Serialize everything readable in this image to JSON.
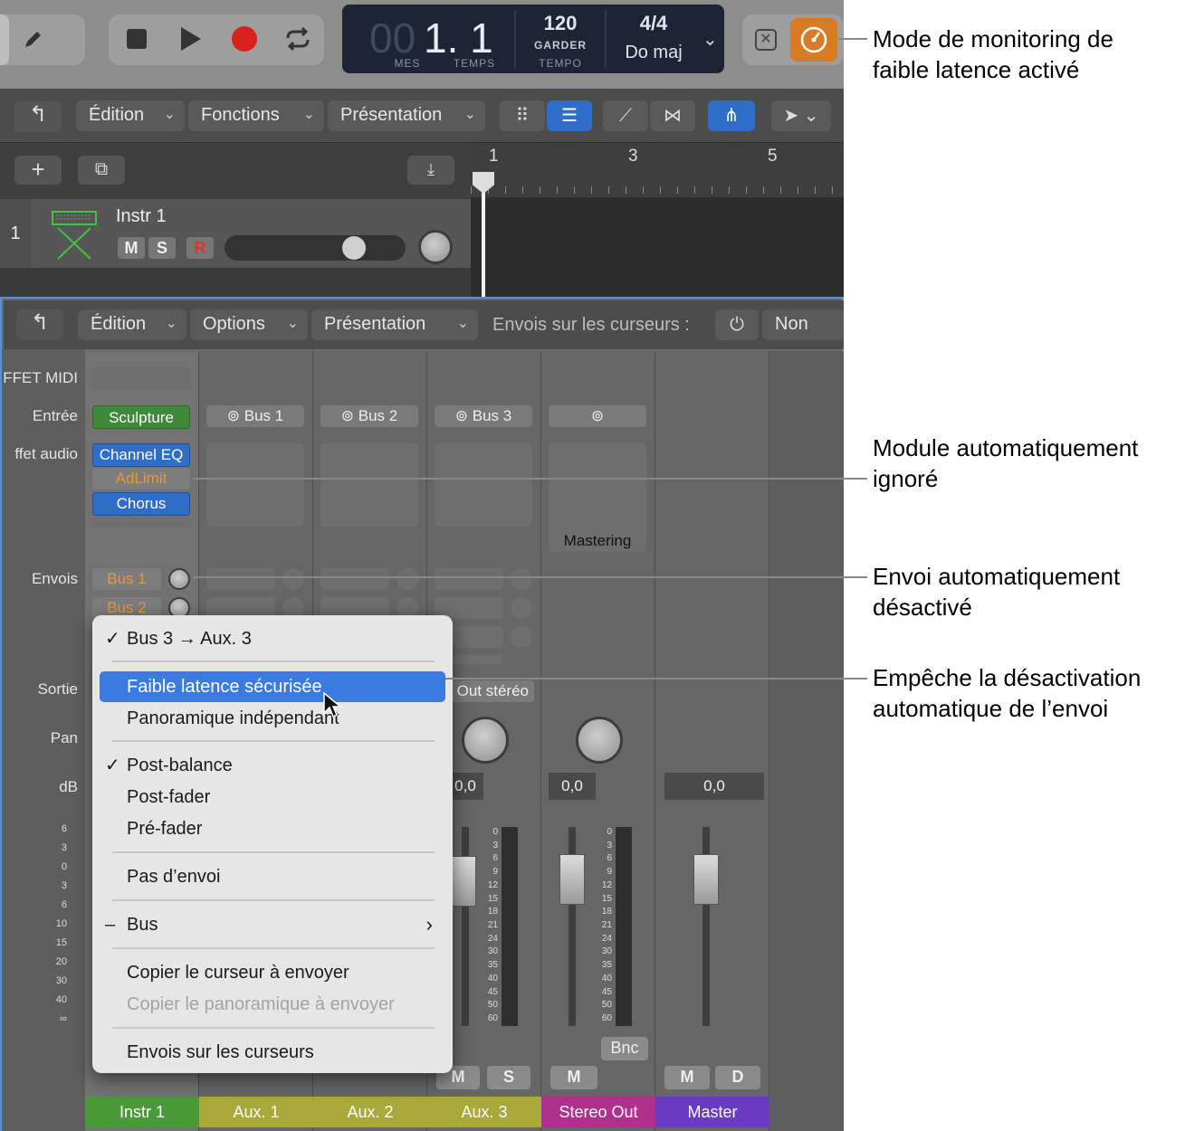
{
  "transport": {
    "lcd_bars": "00",
    "lcd_beat": "1. 1",
    "lcd_label_bars": "MES",
    "lcd_label_beat": "TEMPS",
    "tempo_value": "120",
    "tempo_mode": "GARDER",
    "tempo_label": "TEMPO",
    "signature": "4/4",
    "key": "Do maj"
  },
  "main_menubar": {
    "edit": "Édition",
    "functions": "Fonctions",
    "view": "Présentation"
  },
  "ruler": [
    "1",
    "3",
    "5"
  ],
  "track": {
    "number": "1",
    "name": "Instr 1",
    "mute": "M",
    "solo": "S",
    "record": "R"
  },
  "mixer_menubar": {
    "edit": "Édition",
    "options": "Options",
    "view": "Présentation",
    "sends_on_faders_label": "Envois sur les curseurs :",
    "sends_on_faders_value": "Non"
  },
  "row_labels": {
    "midi_fx": "FFET MIDI",
    "input": "Entrée",
    "audio_fx": "ffet audio",
    "sends": "Envois",
    "output": "Sortie",
    "pan": "Pan",
    "db": "dB"
  },
  "strip1": {
    "input": "Sculpture",
    "plugins": [
      "Channel EQ",
      "AdLimit",
      "Chorus"
    ],
    "sends": [
      "Bus 1",
      "Bus 2"
    ]
  },
  "inputs": [
    "Bus 1",
    "Bus 2",
    "Bus 3"
  ],
  "stereo_out": {
    "plugin": "Mastering",
    "output_fragment": "Out stéréo",
    "db": "0,0",
    "mute": "M",
    "bounce": "Bnc"
  },
  "aux3": {
    "db": "0,0",
    "mute": "M",
    "solo": "S"
  },
  "master": {
    "db": "0,0",
    "mute": "M",
    "dim": "D"
  },
  "strip_names": [
    "Instr 1",
    "Aux. 1",
    "Aux. 2",
    "Aux. 3",
    "Stereo Out",
    "Master"
  ],
  "strip_colors": [
    "#4a9a3a",
    "#a9a83a",
    "#a9a83a",
    "#a9a83a",
    "#b0318d",
    "#6a3bbf"
  ],
  "fader_scale_left": [
    "6",
    "3",
    "0",
    "3",
    "6",
    "10",
    "15",
    "20",
    "30",
    "40",
    "∞"
  ],
  "fader_scale_right": [
    "0",
    "3",
    "6",
    "9",
    "12",
    "15",
    "18",
    "21",
    "24",
    "30",
    "35",
    "40",
    "45",
    "50",
    "60"
  ],
  "context_menu": {
    "route": "Bus 3 → Aux. 3",
    "items_group1": [
      "Faible latence sécurisée",
      "Panoramique indépendant"
    ],
    "items_group2": [
      "Post-balance",
      "Post-fader",
      "Pré-fader"
    ],
    "no_send": "Pas d’envoi",
    "bus": "Bus",
    "copy_fader": "Copier le curseur à envoyer",
    "copy_pan": "Copier le panoramique à envoyer",
    "sends_on_faders": "Envois sur les curseurs"
  },
  "annotations": {
    "low_latency_mode": "Mode de monitoring de faible latence activé",
    "plugin_bypassed": "Module automatiquement ignoré",
    "send_disabled": "Envoi automatiquement désactivé",
    "prevent_disable": "Empêche la désactivation automatique de l’envoi"
  },
  "colors": {
    "accent_blue": "#2f6ec8",
    "low_latency_orange": "#d77b27",
    "bypass_orange": "#e39a3c"
  },
  "icons": [
    "pencil-icon",
    "stop-icon",
    "play-icon",
    "record-icon",
    "cycle-icon",
    "chevron-down-icon",
    "cancel-icon",
    "low-latency-gauge-icon",
    "back-arrow-icon",
    "grid-view-icon",
    "list-view-icon",
    "automation-icon",
    "flex-icon",
    "catch-icon",
    "pointer-tool-icon",
    "plus-icon",
    "duplicate-icon",
    "import-icon",
    "keyboard-icon",
    "power-icon",
    "link-icon",
    "checkmark-icon",
    "chevron-right-icon",
    "mouse-cursor-icon"
  ]
}
